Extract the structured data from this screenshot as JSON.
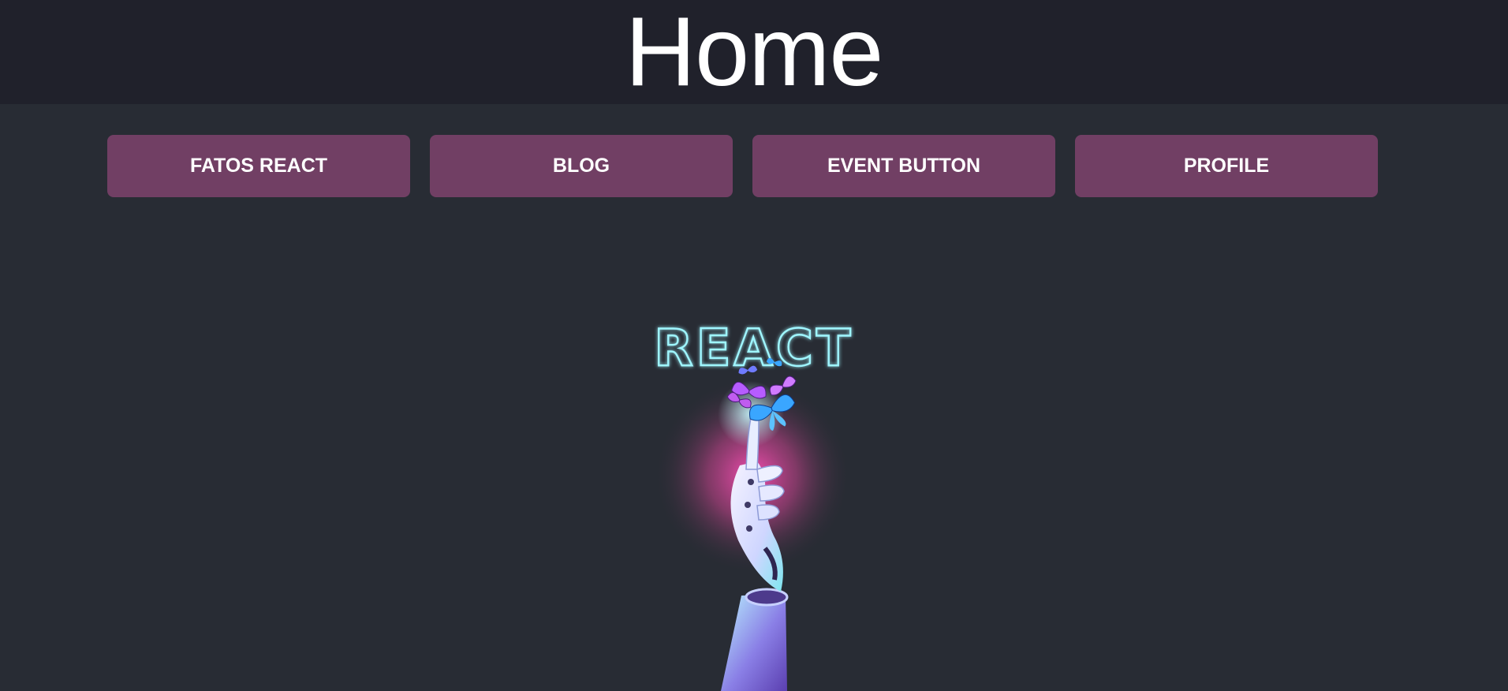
{
  "header": {
    "title": "Home",
    "background": "#20212b"
  },
  "nav": {
    "items": [
      {
        "label": "FATOS REACT"
      },
      {
        "label": "BLOG"
      },
      {
        "label": "EVENT BUTTON"
      },
      {
        "label": "PROFILE"
      }
    ],
    "button_color": "#713f64"
  },
  "hero": {
    "logo_text": "REACT",
    "image": "robot-hand-with-butterflies",
    "glow_color": "#ff4fb8",
    "neon_color": "#9ff6ff"
  },
  "page": {
    "background": "#282c34"
  }
}
